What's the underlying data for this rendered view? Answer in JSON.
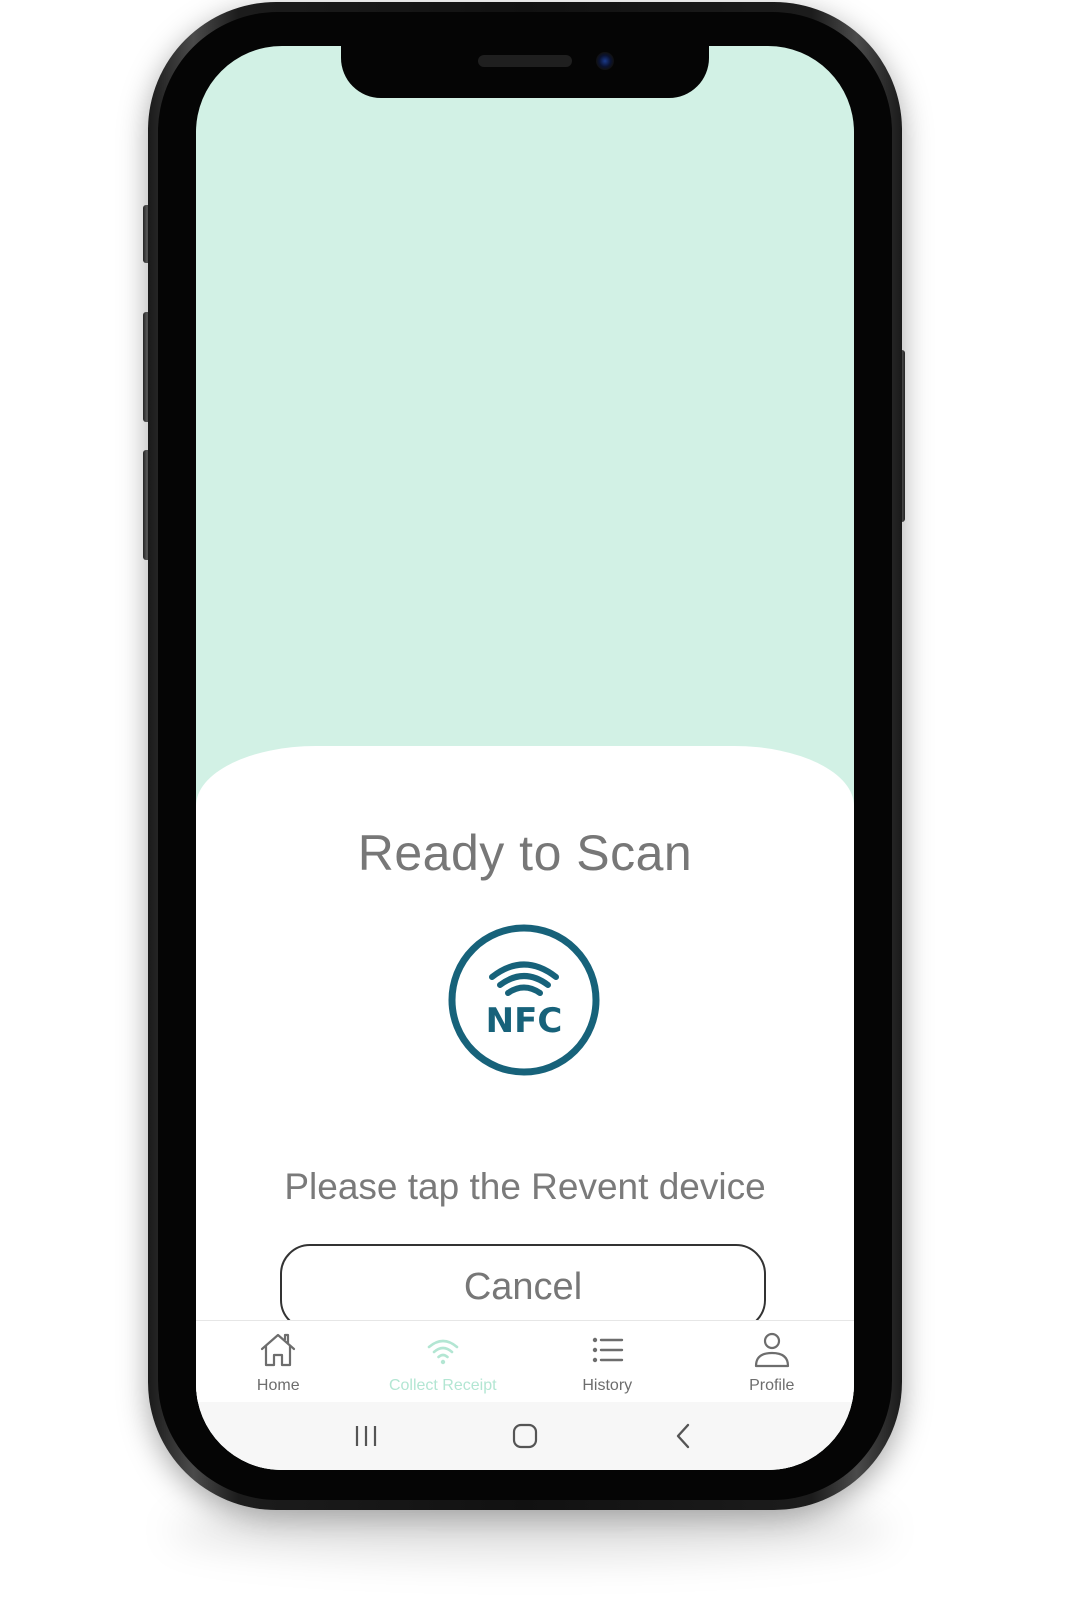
{
  "sheet": {
    "title": "Ready to Scan",
    "nfc_badge_text": "NFC",
    "message": "Please tap the Revent device",
    "cancel_label": "Cancel"
  },
  "tabbar": {
    "items": [
      {
        "label": "Home",
        "icon": "home-icon",
        "active": false
      },
      {
        "label": "Collect Receipt",
        "icon": "wifi-icon",
        "active": true
      },
      {
        "label": "History",
        "icon": "list-icon",
        "active": false
      },
      {
        "label": "Profile",
        "icon": "user-icon",
        "active": false
      }
    ]
  },
  "system_nav": {
    "items": [
      "recent-apps-icon",
      "home-button-icon",
      "back-icon"
    ]
  },
  "colors": {
    "background_mint": "#d2f1e5",
    "nfc_teal": "#17627a",
    "active_tab": "#b3e6d3",
    "text_gray": "#777777"
  }
}
